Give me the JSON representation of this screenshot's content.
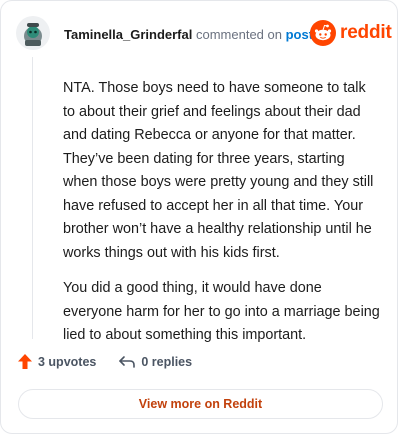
{
  "header": {
    "username": "Taminella_Grinderfal",
    "action_text": "commented on",
    "post_link": "post",
    "brand": "reddit"
  },
  "comment": {
    "paragraphs": [
      "NTA. Those boys need to have someone to talk to about their grief and feelings about their dad and dating Rebecca or anyone for that matter. They’ve been dating for three years, starting when those boys were pretty young and they still have refused to accept her in all that time. Your brother won’t have a healthy relationship until he works things out with his kids first.",
      "You did a good thing, it would have done everyone harm for her to go into a marriage being lied to about something this important."
    ]
  },
  "actions": {
    "upvotes": "3 upvotes",
    "replies": "0 replies"
  },
  "footer": {
    "view_more": "View more on Reddit"
  },
  "colors": {
    "brand": "#ff4500",
    "link": "#0079d3",
    "view_more": "#c2410c"
  },
  "icons": {
    "avatar": "snoo-avatar-icon",
    "logo": "reddit-snoo-icon",
    "upvote": "upvote-arrow-icon",
    "reply": "reply-arrow-icon"
  }
}
